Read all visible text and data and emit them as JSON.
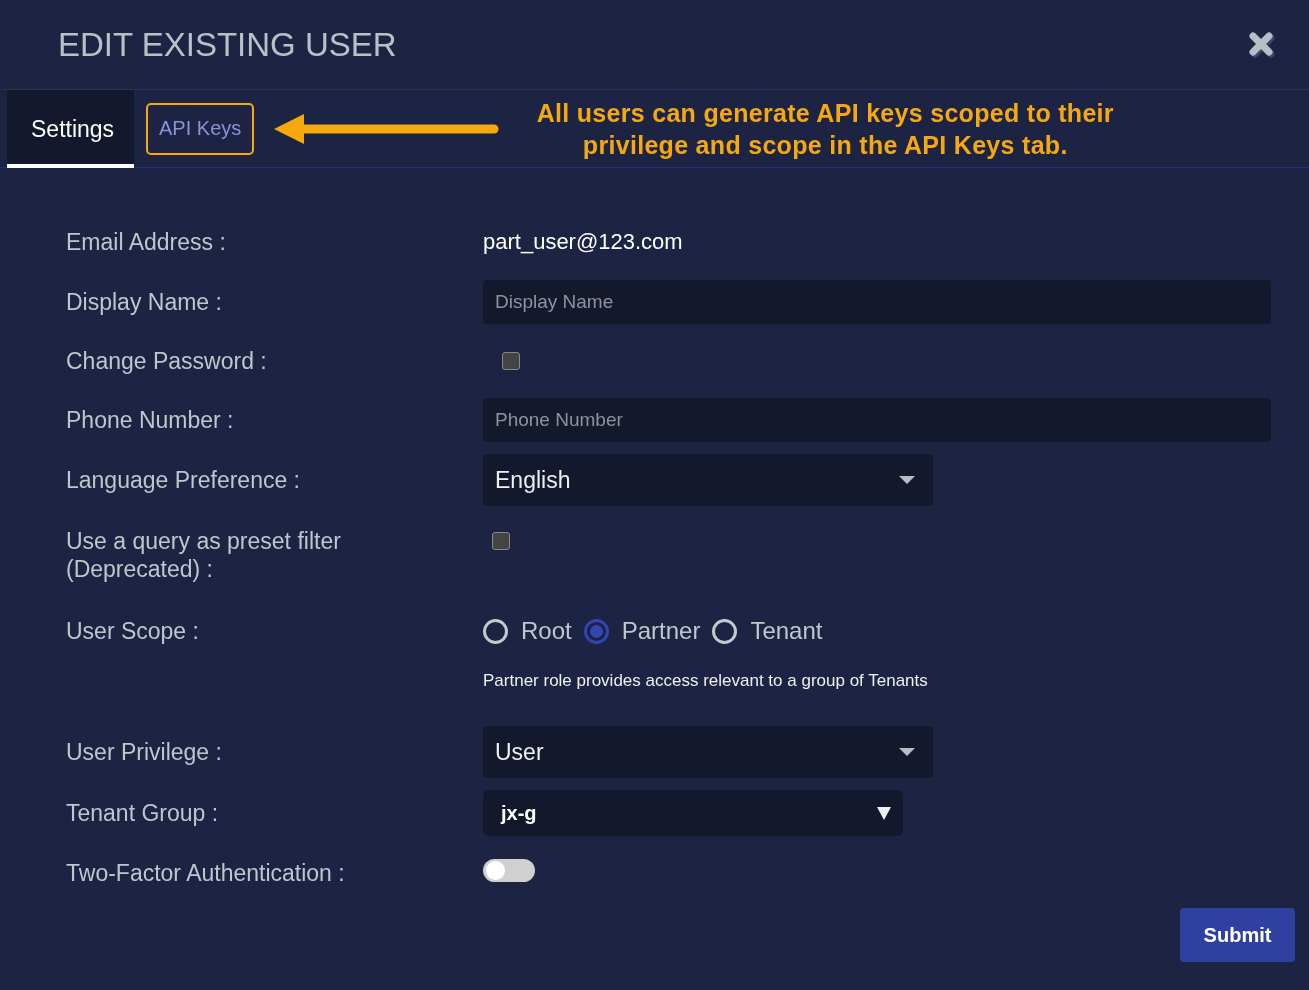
{
  "dialog": {
    "title": "EDIT EXISTING USER"
  },
  "tabs": [
    {
      "label": "Settings",
      "selected": true,
      "highlighted": false
    },
    {
      "label": "API Keys",
      "selected": false,
      "highlighted": true
    }
  ],
  "annotation": {
    "text": "All users can generate API keys scoped to their privilege and scope in the API Keys tab."
  },
  "fields": [
    {
      "kind": "text",
      "label": "Email Address :",
      "value": "part_user@123.com"
    },
    {
      "kind": "input",
      "label": "Display Name :",
      "placeholder": "Display Name"
    },
    {
      "kind": "checkbox",
      "label": "Change Password :",
      "checked": false
    },
    {
      "kind": "input",
      "label": "Phone Number :",
      "placeholder": "Phone Number"
    },
    {
      "kind": "select",
      "label": "Language Preference :",
      "value": "English"
    },
    {
      "kind": "checkbox",
      "label": "Use a query as preset filter (Deprecated) :",
      "checked": false
    },
    {
      "kind": "radio",
      "label": "User Scope :",
      "options": [
        {
          "label": "Root",
          "selected": false
        },
        {
          "label": "Partner",
          "selected": true
        },
        {
          "label": "Tenant",
          "selected": false
        }
      ],
      "help": "Partner role provides access relevant to a group of Tenants"
    },
    {
      "kind": "select",
      "label": "User Privilege :",
      "value": "User"
    },
    {
      "kind": "native_select",
      "label": "Tenant Group :",
      "value": "jx-g"
    },
    {
      "kind": "toggle",
      "label": "Two-Factor Authentication :",
      "on": false
    }
  ],
  "submit": {
    "label": "Submit"
  }
}
